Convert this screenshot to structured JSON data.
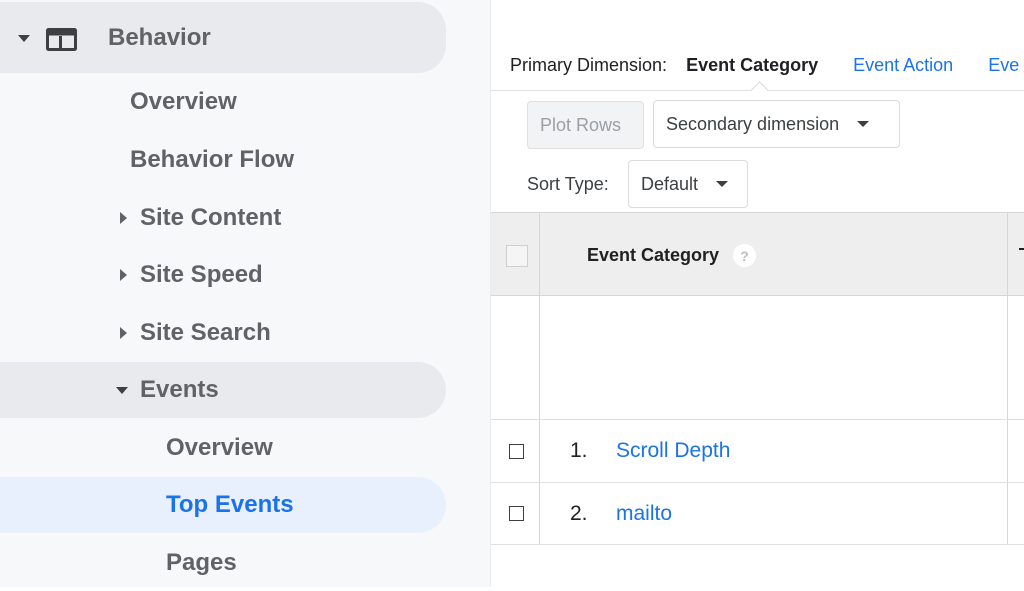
{
  "sidebar": {
    "section": {
      "label": "Behavior",
      "icon": "behavior-layout-icon",
      "expanded": true
    },
    "items": [
      {
        "label": "Overview",
        "level": 1,
        "caret": "none"
      },
      {
        "label": "Behavior Flow",
        "level": 1,
        "caret": "none"
      },
      {
        "label": "Site Content",
        "level": 1,
        "caret": "right"
      },
      {
        "label": "Site Speed",
        "level": 1,
        "caret": "right"
      },
      {
        "label": "Site Search",
        "level": 1,
        "caret": "right"
      },
      {
        "label": "Events",
        "level": 1,
        "caret": "down"
      },
      {
        "label": "Overview",
        "level": 2,
        "caret": "none"
      },
      {
        "label": "Top Events",
        "level": 2,
        "caret": "none",
        "active": true
      },
      {
        "label": "Pages",
        "level": 2,
        "caret": "none"
      }
    ]
  },
  "main": {
    "primary_dimension": {
      "label": "Primary Dimension:",
      "active": "Event Category",
      "options": [
        "Event Action",
        "Eve"
      ]
    },
    "toolbar": {
      "plot_rows": "Plot Rows",
      "secondary_dimension": "Secondary dimension",
      "sort_type_label": "Sort Type:",
      "sort_type_value": "Default"
    },
    "table": {
      "column_header": "Event Category",
      "help_icon": "?",
      "rows": [
        {
          "num": "1.",
          "label": "Scroll Depth"
        },
        {
          "num": "2.",
          "label": "mailto"
        }
      ]
    }
  },
  "colors": {
    "link": "#1a73e8",
    "active_bg": "#e8f0fe",
    "highlight_bg": "#e8eaed",
    "sidebar_bg": "#f7f8fa",
    "header_bg": "#eeeeee"
  }
}
